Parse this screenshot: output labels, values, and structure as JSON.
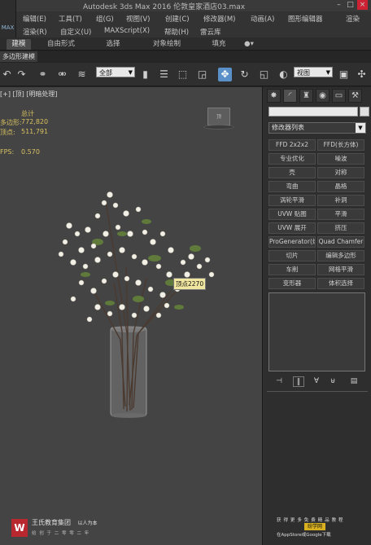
{
  "window": {
    "title": "Autodesk 3ds Max 2016      伦敦皇家酒店03.max",
    "app_badge": "MAX",
    "controls": [
      "–",
      "□",
      "×"
    ]
  },
  "menu": {
    "row1": [
      "编辑(E)",
      "工具(T)",
      "组(G)",
      "视图(V)",
      "创建(C)",
      "修改器(M)",
      "动画(A)",
      "图形编辑器",
      "渲染"
    ],
    "row2": [
      "渲染(R)",
      "自定义(U)",
      "MAXScript(X)",
      "帮助(H)",
      "雷云库"
    ]
  },
  "ribbon": {
    "tabs": [
      "建模",
      "自由形式",
      "选择",
      "对象绘制",
      "填充"
    ],
    "active_tab": "建模",
    "subtab": "多边形建模"
  },
  "toolbar": {
    "filter_dropdown": "全部",
    "coord_dropdown": "视图"
  },
  "viewport": {
    "label": "[+] [顶] [明暗处理]",
    "stats_header": "总计",
    "stats": [
      {
        "label": "多边形:",
        "value": "772,820"
      },
      {
        "label": "顶点:",
        "value": "511,791"
      }
    ],
    "fps_label": "FPS:",
    "fps_value": "0.570",
    "viewcube_label": "顶",
    "tooltip": "顶点2270"
  },
  "command_panel": {
    "modifier_list": "修改器列表",
    "modifier_buttons": [
      "FFD 2x2x2",
      "FFD(长方体)",
      "专业优化",
      "噪波",
      "壳",
      "对称",
      "弯曲",
      "晶格",
      "涡轮平滑",
      "补洞",
      "UVW 贴图",
      "平滑",
      "UVW 展开",
      "挤压",
      "ProGenerator(烘焙)",
      "Quad Chamfer",
      "切片",
      "编辑多边形",
      "车削",
      "网格平滑",
      "变形器",
      "体积选择"
    ]
  },
  "watermark": {
    "logo_letter": "W",
    "company": "王氏教育集团",
    "company_tag": "以人为本",
    "slogan": "给 创 于 二 零 零 二 年",
    "right_line1": "获 得 更 多 免 费 精 品 教 程",
    "right_badge": "纷学网",
    "right_line3": "在AppStore或Google下载"
  }
}
